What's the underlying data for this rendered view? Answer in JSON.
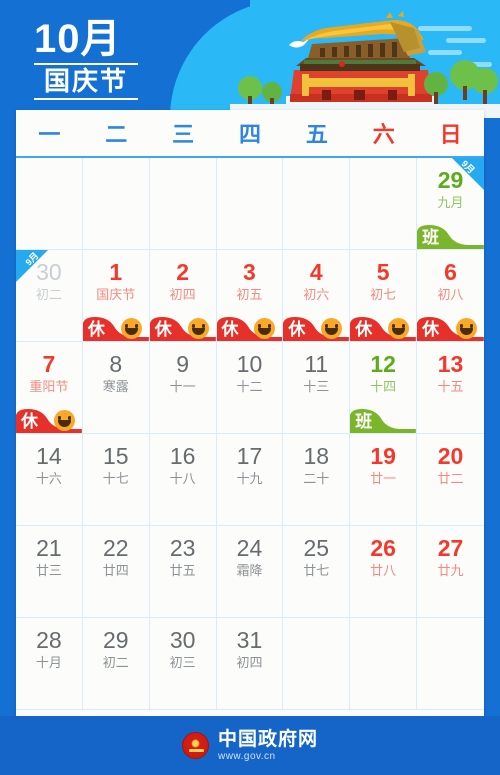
{
  "header": {
    "month_label": "10月",
    "festival_label": "国庆节",
    "illustration": "tiananmen-gate",
    "colors": {
      "deep_blue": "#1570d3",
      "sky_blue": "#2bb8f7",
      "roof_gold": "#e8a822",
      "wall_red": "#e04434",
      "tree_green": "#6dc04a"
    }
  },
  "calendar": {
    "weekdays": [
      {
        "label": "一",
        "weekend": false
      },
      {
        "label": "二",
        "weekend": false
      },
      {
        "label": "三",
        "weekend": false
      },
      {
        "label": "四",
        "weekend": false
      },
      {
        "label": "五",
        "weekend": false
      },
      {
        "label": "六",
        "weekend": true
      },
      {
        "label": "日",
        "weekend": true
      }
    ],
    "days": [
      {
        "num": "",
        "sub": "",
        "style": "empty"
      },
      {
        "num": "",
        "sub": "",
        "style": "empty"
      },
      {
        "num": "",
        "sub": "",
        "style": "empty"
      },
      {
        "num": "",
        "sub": "",
        "style": "empty"
      },
      {
        "num": "",
        "sub": "",
        "style": "empty"
      },
      {
        "num": "",
        "sub": "",
        "style": "empty"
      },
      {
        "num": "29",
        "sub": "九月",
        "style": "green",
        "corner": "9月",
        "corner_pos": "tr",
        "badge": "班",
        "badge_type": "work"
      },
      {
        "num": "30",
        "sub": "初二",
        "style": "out",
        "corner": "9月",
        "corner_pos": "tl"
      },
      {
        "num": "1",
        "sub": "国庆节",
        "style": "hol",
        "badge": "休",
        "badge_type": "rest"
      },
      {
        "num": "2",
        "sub": "初四",
        "style": "hol",
        "badge": "休",
        "badge_type": "rest"
      },
      {
        "num": "3",
        "sub": "初五",
        "style": "hol",
        "badge": "休",
        "badge_type": "rest"
      },
      {
        "num": "4",
        "sub": "初六",
        "style": "hol",
        "badge": "休",
        "badge_type": "rest"
      },
      {
        "num": "5",
        "sub": "初七",
        "style": "hol",
        "badge": "休",
        "badge_type": "rest"
      },
      {
        "num": "6",
        "sub": "初八",
        "style": "hol",
        "badge": "休",
        "badge_type": "rest"
      },
      {
        "num": "7",
        "sub": "重阳节",
        "style": "hol",
        "badge": "休",
        "badge_type": "rest"
      },
      {
        "num": "8",
        "sub": "寒露",
        "style": "normal"
      },
      {
        "num": "9",
        "sub": "十一",
        "style": "normal"
      },
      {
        "num": "10",
        "sub": "十二",
        "style": "normal"
      },
      {
        "num": "11",
        "sub": "十三",
        "style": "normal"
      },
      {
        "num": "12",
        "sub": "十四",
        "style": "green",
        "badge": "班",
        "badge_type": "work"
      },
      {
        "num": "13",
        "sub": "十五",
        "style": "red"
      },
      {
        "num": "14",
        "sub": "十六",
        "style": "normal"
      },
      {
        "num": "15",
        "sub": "十七",
        "style": "normal"
      },
      {
        "num": "16",
        "sub": "十八",
        "style": "normal"
      },
      {
        "num": "17",
        "sub": "十九",
        "style": "normal"
      },
      {
        "num": "18",
        "sub": "二十",
        "style": "normal"
      },
      {
        "num": "19",
        "sub": "廿一",
        "style": "red"
      },
      {
        "num": "20",
        "sub": "廿二",
        "style": "red"
      },
      {
        "num": "21",
        "sub": "廿三",
        "style": "normal"
      },
      {
        "num": "22",
        "sub": "廿四",
        "style": "normal"
      },
      {
        "num": "23",
        "sub": "廿五",
        "style": "normal"
      },
      {
        "num": "24",
        "sub": "霜降",
        "style": "normal"
      },
      {
        "num": "25",
        "sub": "廿七",
        "style": "normal"
      },
      {
        "num": "26",
        "sub": "廿八",
        "style": "red"
      },
      {
        "num": "27",
        "sub": "廿九",
        "style": "red"
      },
      {
        "num": "28",
        "sub": "十月",
        "style": "normal"
      },
      {
        "num": "29",
        "sub": "初二",
        "style": "normal"
      },
      {
        "num": "30",
        "sub": "初三",
        "style": "normal"
      },
      {
        "num": "31",
        "sub": "初四",
        "style": "normal"
      },
      {
        "num": "",
        "sub": "",
        "style": "empty"
      },
      {
        "num": "",
        "sub": "",
        "style": "empty"
      },
      {
        "num": "",
        "sub": "",
        "style": "empty"
      }
    ]
  },
  "footer": {
    "site_name": "中国政府网",
    "url": "www.gov.cn",
    "emblem": "national-emblem-icon"
  }
}
